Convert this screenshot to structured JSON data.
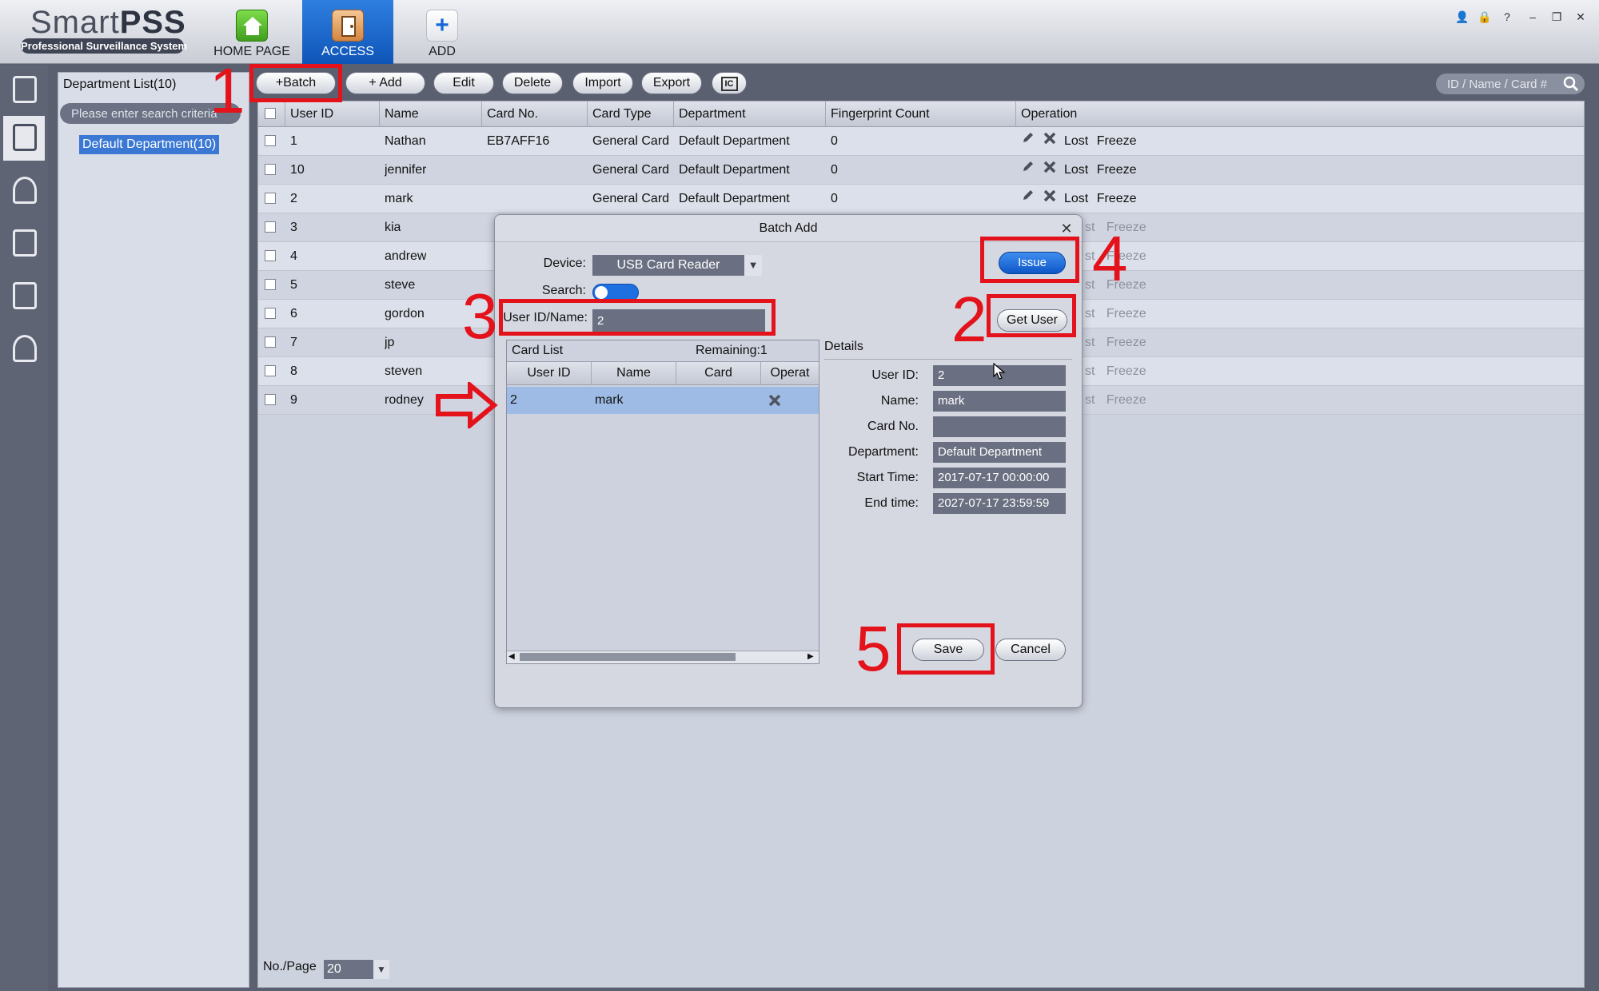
{
  "app": {
    "brand_light": "Smart",
    "brand_bold": "PSS",
    "subtitle": "Professional Surveillance System"
  },
  "nav": {
    "home": "HOME PAGE",
    "access": "ACCESS",
    "add": "ADD"
  },
  "window_icons": [
    "user-icon",
    "lock-icon",
    "help-icon",
    "minimize-icon",
    "restore-icon",
    "close-icon"
  ],
  "window_glyphs": [
    "👤",
    "🔒",
    "?",
    "–",
    "❐",
    "✕"
  ],
  "department": {
    "title": "Department List(10)",
    "search_placeholder": "Please enter search criteria",
    "item": "Default Department(10)"
  },
  "toolbar": {
    "batch": "Batch",
    "add": "Add",
    "edit": "Edit",
    "delete": "Delete",
    "import": "Import",
    "export": "Export",
    "card_icon_text": "IC",
    "search_placeholder": "ID / Name / Card #"
  },
  "table": {
    "columns": [
      "User ID",
      "Name",
      "Card No.",
      "Card Type",
      "Department",
      "Fingerprint Count",
      "Operation"
    ],
    "rows": [
      {
        "id": "1",
        "name": "Nathan",
        "card": "EB7AFF16",
        "type": "General Card",
        "dept": "Default Department",
        "fp": "0"
      },
      {
        "id": "10",
        "name": "jennifer",
        "card": "",
        "type": "General Card",
        "dept": "Default Department",
        "fp": "0"
      },
      {
        "id": "2",
        "name": "mark",
        "card": "",
        "type": "General Card",
        "dept": "Default Department",
        "fp": "0"
      },
      {
        "id": "3",
        "name": "kia",
        "card": "",
        "type": "",
        "dept": "",
        "fp": ""
      },
      {
        "id": "4",
        "name": "andrew",
        "card": "",
        "type": "",
        "dept": "",
        "fp": ""
      },
      {
        "id": "5",
        "name": "steve",
        "card": "",
        "type": "",
        "dept": "",
        "fp": ""
      },
      {
        "id": "6",
        "name": "gordon",
        "card": "",
        "type": "",
        "dept": "",
        "fp": ""
      },
      {
        "id": "7",
        "name": "jp",
        "card": "",
        "type": "",
        "dept": "",
        "fp": ""
      },
      {
        "id": "8",
        "name": "steven",
        "card": "",
        "type": "",
        "dept": "",
        "fp": ""
      },
      {
        "id": "9",
        "name": "rodney",
        "card": "",
        "type": "",
        "dept": "",
        "fp": ""
      }
    ],
    "op_lost": "Lost",
    "op_freeze": "Freeze",
    "op_lost_partial": "st",
    "pager_label": "No./Page",
    "pager_value": "20"
  },
  "dialog": {
    "title": "Batch Add",
    "device_label": "Device:",
    "device_value": "USB Card Reader",
    "search_label": "Search:",
    "userid_label": "User ID/Name:",
    "userid_value": "2",
    "issue": "Issue",
    "get_user": "Get User",
    "card_list_title": "Card List",
    "remaining": "Remaining:1",
    "card_columns": [
      "User ID",
      "Name",
      "Card",
      "Operat"
    ],
    "card_row": {
      "id": "2",
      "name": "mark",
      "card": ""
    },
    "details_label": "Details",
    "details": [
      {
        "label": "User ID:",
        "value": "2"
      },
      {
        "label": "Name:",
        "value": "mark"
      },
      {
        "label": "Card No.",
        "value": ""
      },
      {
        "label": "Department:",
        "value": "Default Department"
      },
      {
        "label": "Start Time:",
        "value": "2017-07-17 00:00:00"
      },
      {
        "label": "End time:",
        "value": "2027-07-17 23:59:59"
      }
    ],
    "save": "Save",
    "cancel": "Cancel"
  },
  "annotations": {
    "numbers": [
      "1",
      "2",
      "3",
      "4",
      "5"
    ],
    "color": "#e3121b"
  },
  "colors": {
    "accent_blue": "#1666d8",
    "panel": "#cdd2df",
    "selected_row": "#9ebbe6"
  }
}
